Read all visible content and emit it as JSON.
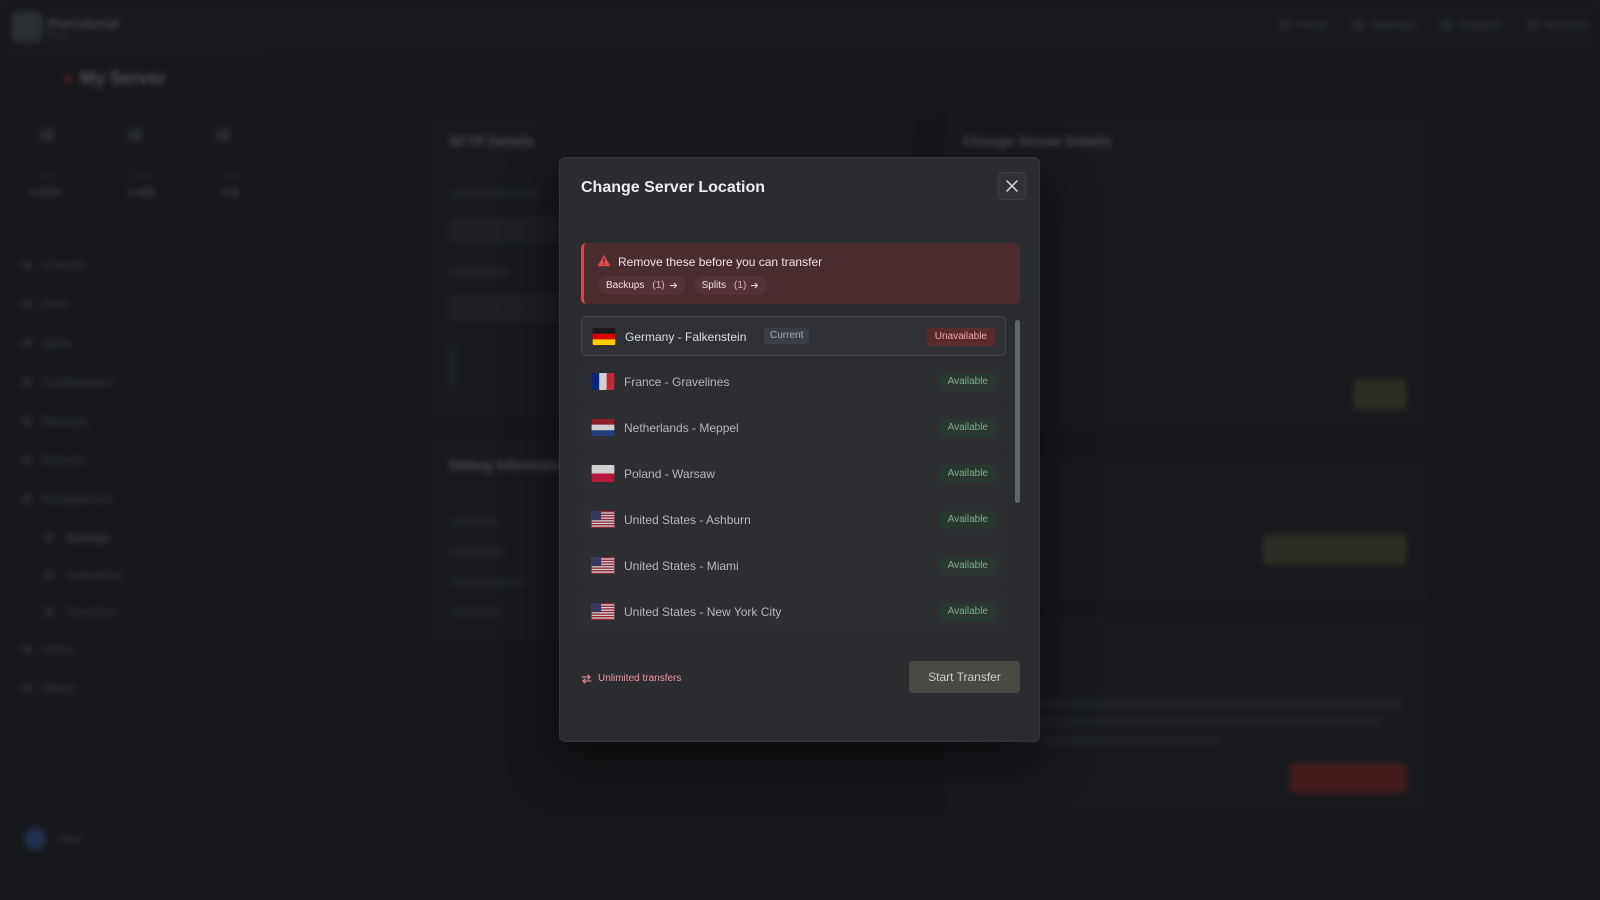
{
  "app": {
    "brand_line1": "Pterodactyl",
    "brand_line2": "Panel",
    "top_links": [
      "Panel",
      "Settings",
      "Support",
      "Account"
    ]
  },
  "sidebar": {
    "server_name": "My Server",
    "server_sub": "",
    "stats": [
      {
        "label": "CPU",
        "value": "0.00%"
      },
      {
        "label": "RAM",
        "value": "0 MB"
      },
      {
        "label": "DISK",
        "value": "0 B"
      }
    ],
    "nav": [
      "Console",
      "Files",
      "Splits",
      "Configuration",
      "Backups",
      "Network",
      "Management",
      "Settings",
      "Schedules",
      "Transfers",
      "Users",
      "Billing"
    ],
    "user_name": "User"
  },
  "background": {
    "panel1_title": "SFTP Details",
    "panel2_title": "Debug Information",
    "panel3_title": "Change Server Details"
  },
  "modal": {
    "title": "Change Server Location",
    "alert": {
      "text": "Remove these before you can transfer",
      "chips": [
        {
          "label": "Backups",
          "count": "(1)"
        },
        {
          "label": "Splits",
          "count": "(1)"
        }
      ]
    },
    "current_tag": "Current",
    "locations": [
      {
        "name": "Germany - Falkenstein",
        "flag": "de",
        "status": "Unavailable",
        "current": true
      },
      {
        "name": "France - Gravelines",
        "flag": "fr",
        "status": "Available",
        "current": false
      },
      {
        "name": "Netherlands - Meppel",
        "flag": "nl",
        "status": "Available",
        "current": false
      },
      {
        "name": "Poland - Warsaw",
        "flag": "pl",
        "status": "Available",
        "current": false
      },
      {
        "name": "United States - Ashburn",
        "flag": "us",
        "status": "Available",
        "current": false
      },
      {
        "name": "United States - Miami",
        "flag": "us",
        "status": "Available",
        "current": false
      },
      {
        "name": "United States - New York City",
        "flag": "us",
        "status": "Available",
        "current": false
      }
    ],
    "transfers_note": "Unlimited transfers",
    "start_button": "Start Transfer",
    "colors": {
      "danger": "#d9484c",
      "available": "#8fd3a3",
      "unavailable": "#f3a6aa"
    }
  }
}
